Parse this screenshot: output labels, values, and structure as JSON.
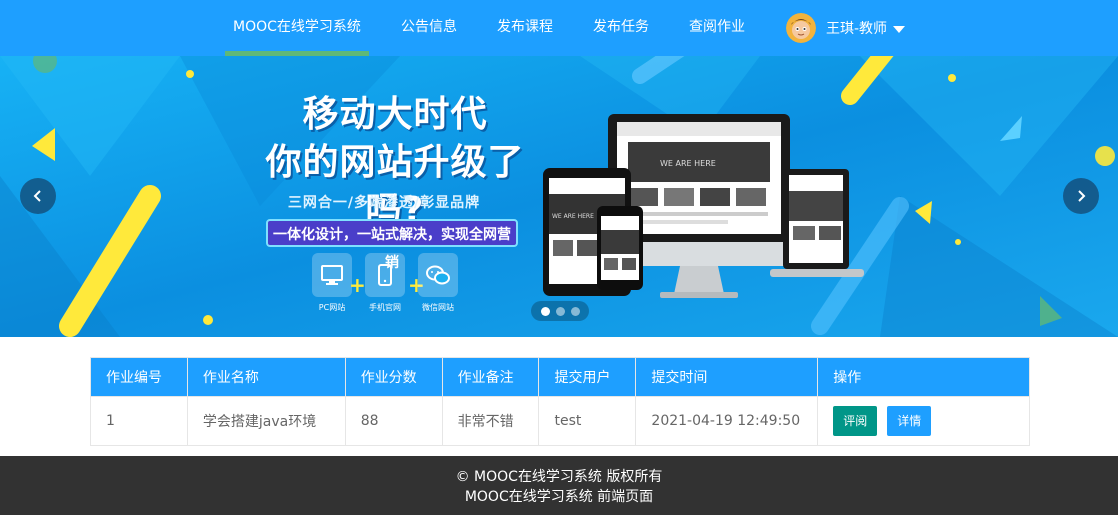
{
  "nav": {
    "items": [
      {
        "label": "MOOC在线学习系统",
        "active": true
      },
      {
        "label": "公告信息"
      },
      {
        "label": "发布课程"
      },
      {
        "label": "发布任务"
      },
      {
        "label": "查阅作业"
      }
    ],
    "user": {
      "name": "王琪-教师"
    }
  },
  "banner": {
    "headline_line1": "移动大时代",
    "headline_line2": "你的网站升级了吗?",
    "tagline": "三网合一/多端渗透/彰显品牌",
    "slogan": "一体化设计，一站式解决，实现全网营销",
    "features": [
      {
        "label": "PC网站",
        "icon": "monitor-icon"
      },
      {
        "label": "手机官网",
        "icon": "phone-icon"
      },
      {
        "label": "微信网站",
        "icon": "wechat-icon"
      }
    ],
    "slide_count": 3,
    "active_slide": 1
  },
  "table": {
    "headers": [
      "作业编号",
      "作业名称",
      "作业分数",
      "作业备注",
      "提交用户",
      "提交时间",
      "操作"
    ],
    "rows": [
      {
        "id": "1",
        "name": "学会搭建java环境",
        "score": "88",
        "remark": "非常不错",
        "user": "test",
        "time": "2021-04-19 12:49:50"
      }
    ],
    "actions": {
      "review": "评阅",
      "detail": "详情"
    }
  },
  "footer": {
    "line1": "© MOOC在线学习系统 版权所有",
    "line2": "MOOC在线学习系统 前端页面"
  },
  "colors": {
    "nav": "#1e9fff",
    "review_button": "#009688",
    "footer": "#323232"
  }
}
